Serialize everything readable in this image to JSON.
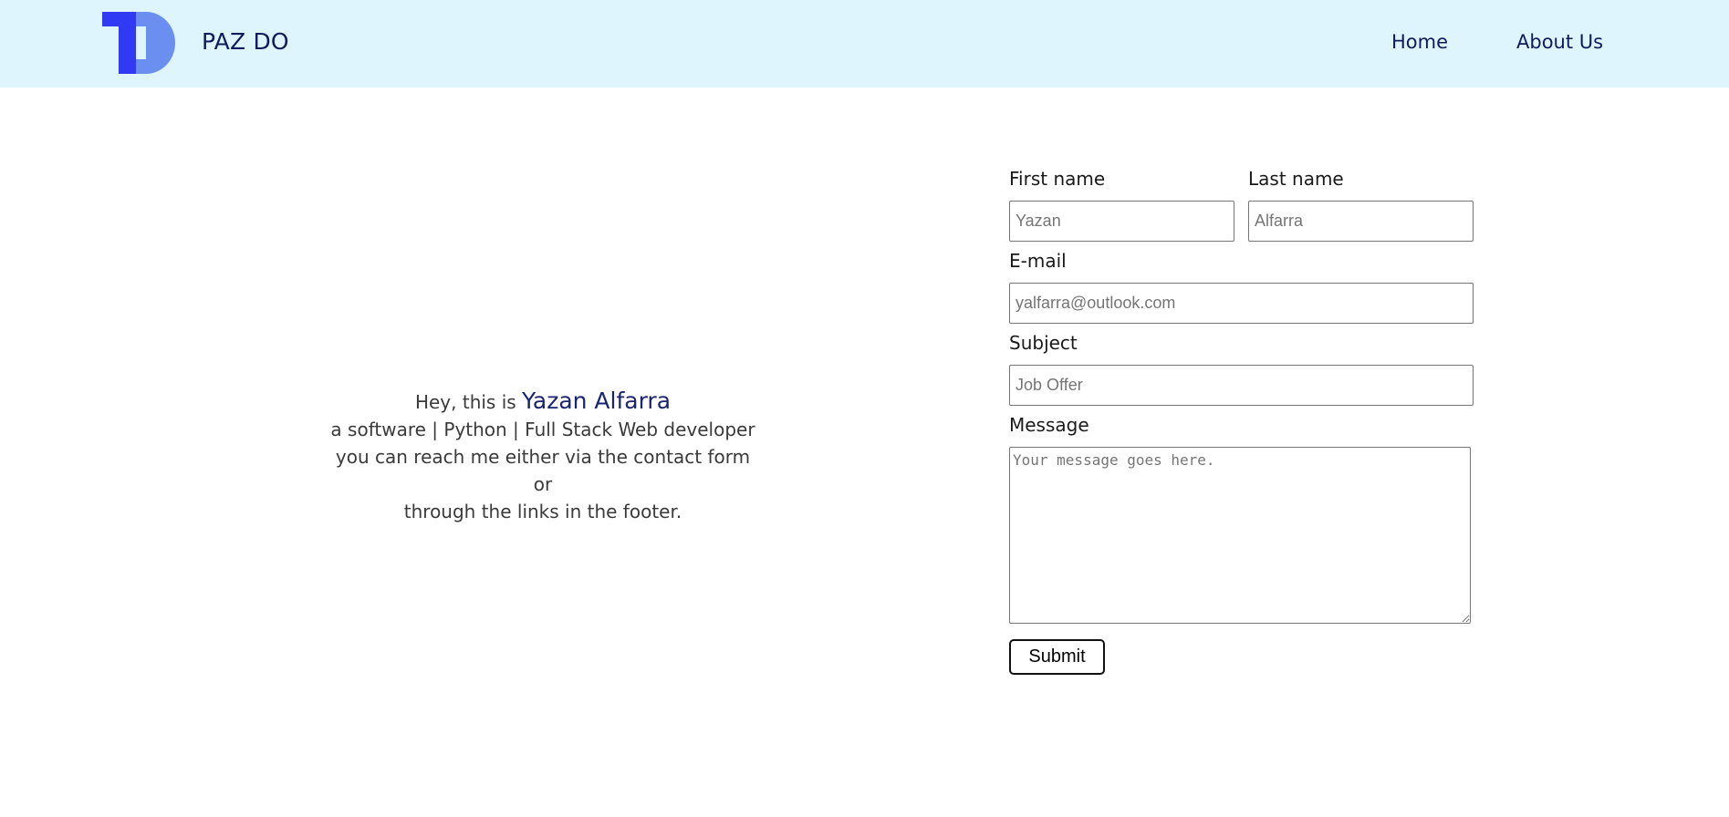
{
  "navbar": {
    "brand": "PAZ DO",
    "links": [
      "Home",
      "About Us"
    ],
    "logo_colors": {
      "dark": "#2f3af2",
      "light": "#6a8ff0"
    },
    "background": "#dff5fd"
  },
  "intro": {
    "greeting": "Hey, this is",
    "name": "Yazan Alfarra",
    "line2": "a software | Python | Full Stack Web developer",
    "line3": "you can reach me either via the contact form or",
    "line4": "through the links in the footer."
  },
  "form": {
    "first_name": {
      "label": "First name",
      "placeholder": "Yazan"
    },
    "last_name": {
      "label": "Last name",
      "placeholder": "Alfarra"
    },
    "email": {
      "label": "E-mail",
      "placeholder": "yalfarra@outlook.com"
    },
    "subject": {
      "label": "Subject",
      "placeholder": "Job Offer"
    },
    "message": {
      "label": "Message",
      "placeholder": "Your message goes here."
    },
    "submit_label": "Submit"
  }
}
